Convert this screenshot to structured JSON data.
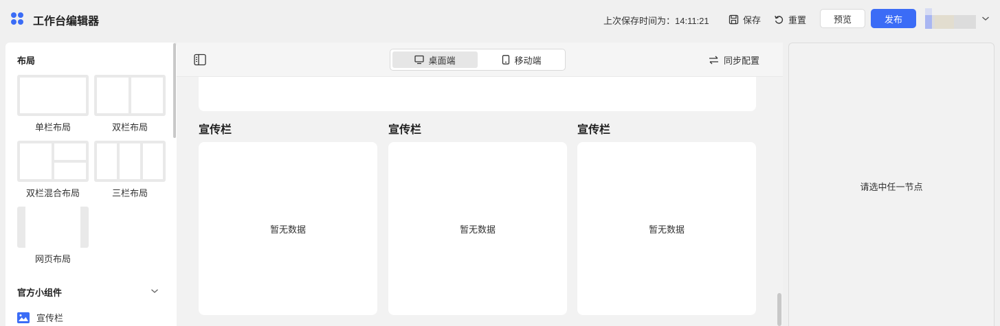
{
  "header": {
    "app_title": "工作台编辑器",
    "save_time": "上次保存时间为：14:11:21",
    "save_label": "保存",
    "reset_label": "重置",
    "preview_label": "预览",
    "publish_label": "发布",
    "logo_icon": "app-grid-icon",
    "colors": {
      "accent": "#3b6cf6",
      "logo": "#3b6cf6"
    }
  },
  "left_panel": {
    "layout_section_title": "布局",
    "layouts": [
      {
        "label": "单栏布局",
        "icon": "single-column-layout-icon"
      },
      {
        "label": "双栏布局",
        "icon": "two-column-layout-icon"
      },
      {
        "label": "双栏混合布局",
        "icon": "mixed-two-column-layout-icon"
      },
      {
        "label": "三栏布局",
        "icon": "three-column-layout-icon"
      },
      {
        "label": "网页布局",
        "icon": "webpage-layout-icon"
      }
    ],
    "widgets_section_title": "官方小组件",
    "widgets": [
      {
        "label": "宣传栏",
        "icon": "banner-icon"
      }
    ]
  },
  "toolbar": {
    "device_tabs": [
      {
        "label": "桌面端",
        "icon": "desktop-icon",
        "active": true
      },
      {
        "label": "移动端",
        "icon": "mobile-icon",
        "active": false
      }
    ],
    "sync_label": "同步配置"
  },
  "canvas": {
    "promo_columns": [
      {
        "title": "宣传栏",
        "empty_text": "暂无数据"
      },
      {
        "title": "宣传栏",
        "empty_text": "暂无数据"
      },
      {
        "title": "宣传栏",
        "empty_text": "暂无数据"
      }
    ]
  },
  "right_panel": {
    "hint": "请选中任一节点"
  }
}
